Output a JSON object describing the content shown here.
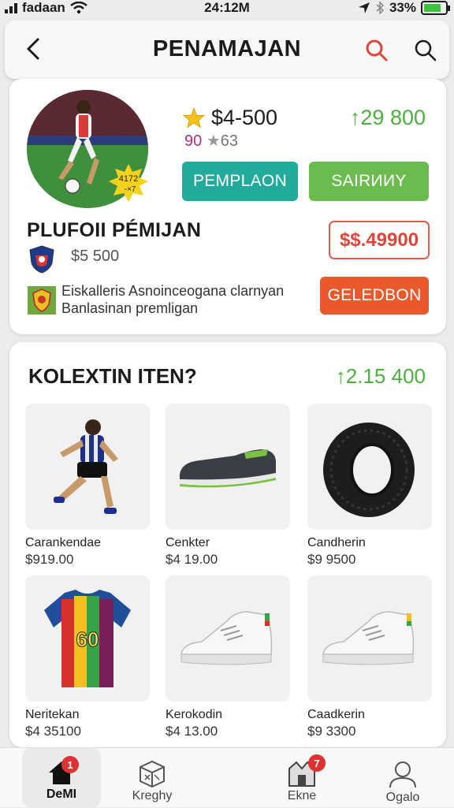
{
  "status": {
    "carrier": "fadaan",
    "time": "24:12M",
    "battery": "33%"
  },
  "header": {
    "title": "PENAMAJAN"
  },
  "player": {
    "rating_value": "$4-500",
    "sub_num": "90",
    "sub_rest": "63",
    "price_green": "↑29 800",
    "badge_text_1": "4172",
    "badge_text_2": "-×7",
    "btn_primary": "PEMPLAON",
    "btn_secondary": "SAIRИИY",
    "name": "PLUFOII PÉMIJAN",
    "price": "$5 500",
    "red_price": "$$.49900",
    "desc": "Eiskalleris Asnoinceogana clarnyan Banlasinan premligan",
    "btn_action": "GELEDBON"
  },
  "collection": {
    "title": "KOLEXTIN ITEN?",
    "total": "↑2.15 400",
    "items": [
      {
        "name": "Carankendae",
        "price": "$919.00",
        "icon": "player-figure"
      },
      {
        "name": "Cenkter",
        "price": "$4 19.00",
        "icon": "shoe"
      },
      {
        "name": "Candherin",
        "price": "$9 9500",
        "icon": "tire"
      },
      {
        "name": "Neritekan",
        "price": "$4 35100",
        "icon": "jersey",
        "jersey_number": "60"
      },
      {
        "name": "Kerokodin",
        "price": "$4 13.00",
        "icon": "sneaker"
      },
      {
        "name": "Caadkerin",
        "price": "$9 3300",
        "icon": "sneaker"
      }
    ]
  },
  "tabbar": {
    "tabs": [
      {
        "label": "DeMI",
        "badge": "1"
      },
      {
        "label": "Kreghy"
      },
      {
        "label": "Ekne",
        "badge": "7"
      },
      {
        "label": "Ogalo"
      }
    ]
  },
  "colors": {
    "teal": "#22aa9a",
    "green": "#6bbc4f",
    "orange": "#e9592c",
    "red": "#e0453a",
    "price_green": "#4caf3f"
  }
}
